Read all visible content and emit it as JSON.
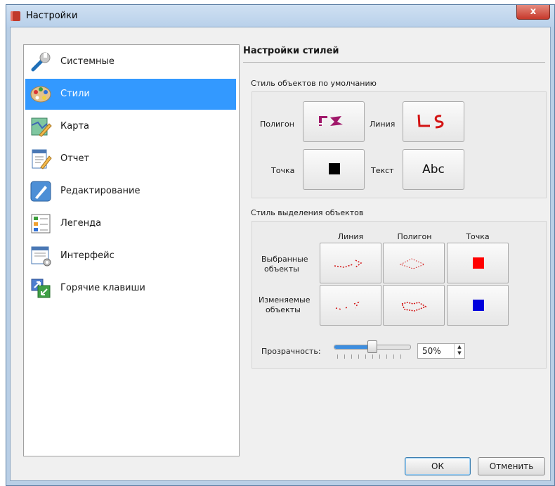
{
  "window": {
    "title": "Настройки",
    "close_glyph": "x"
  },
  "sidebar": {
    "items": [
      {
        "label": "Системные",
        "icon": "wrench-icon"
      },
      {
        "label": "Стили",
        "icon": "palette-icon",
        "selected": true
      },
      {
        "label": "Карта",
        "icon": "map-icon"
      },
      {
        "label": "Отчет",
        "icon": "report-icon"
      },
      {
        "label": "Редактирование",
        "icon": "pen-icon"
      },
      {
        "label": "Легенда",
        "icon": "legend-icon"
      },
      {
        "label": "Интерфейс",
        "icon": "interface-icon"
      },
      {
        "label": "Горячие клавиши",
        "icon": "hotkeys-icon"
      }
    ]
  },
  "main": {
    "title": "Настройки стилей",
    "default_style": {
      "group_title": "Стиль объектов по умолчанию",
      "polygon_label": "Полигон",
      "line_label": "Линия",
      "point_label": "Точка",
      "text_label": "Текст",
      "text_sample": "Abc"
    },
    "selection_style": {
      "group_title": "Стиль выделения объектов",
      "columns": [
        "Линия",
        "Полигон",
        "Точка"
      ],
      "row_selected": [
        "Выбранные",
        "объекты"
      ],
      "row_modified": [
        "Изменяемые",
        "объекты"
      ],
      "transparency_label": "Прозрачность:",
      "transparency_value": "50%",
      "transparency_level": 0.5
    }
  },
  "colors": {
    "selection_blue": "#3399ff",
    "polygon_purple": "#a0186a",
    "line_red": "#d31414",
    "selected_point": "#ff0000",
    "modified_point": "#0000dd"
  },
  "footer": {
    "ok_label": "ОК",
    "cancel_label": "Отменить"
  }
}
